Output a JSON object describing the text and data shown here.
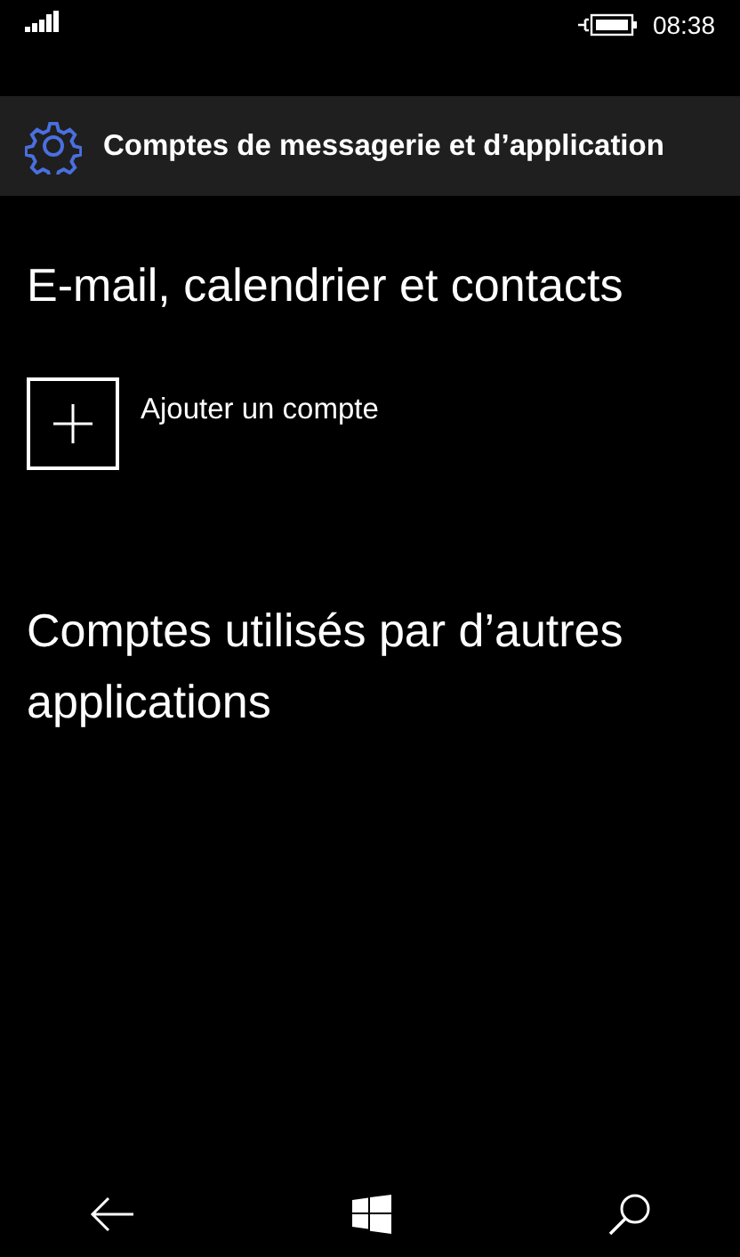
{
  "status_bar": {
    "time": "08:38"
  },
  "header": {
    "title": "Comptes de messagerie et d’application"
  },
  "sections": [
    {
      "title": "E-mail, calendrier et contacts",
      "actions": [
        {
          "label": "Ajouter un compte"
        }
      ]
    },
    {
      "title": "Comptes utilisés par d’autres applications"
    }
  ]
}
